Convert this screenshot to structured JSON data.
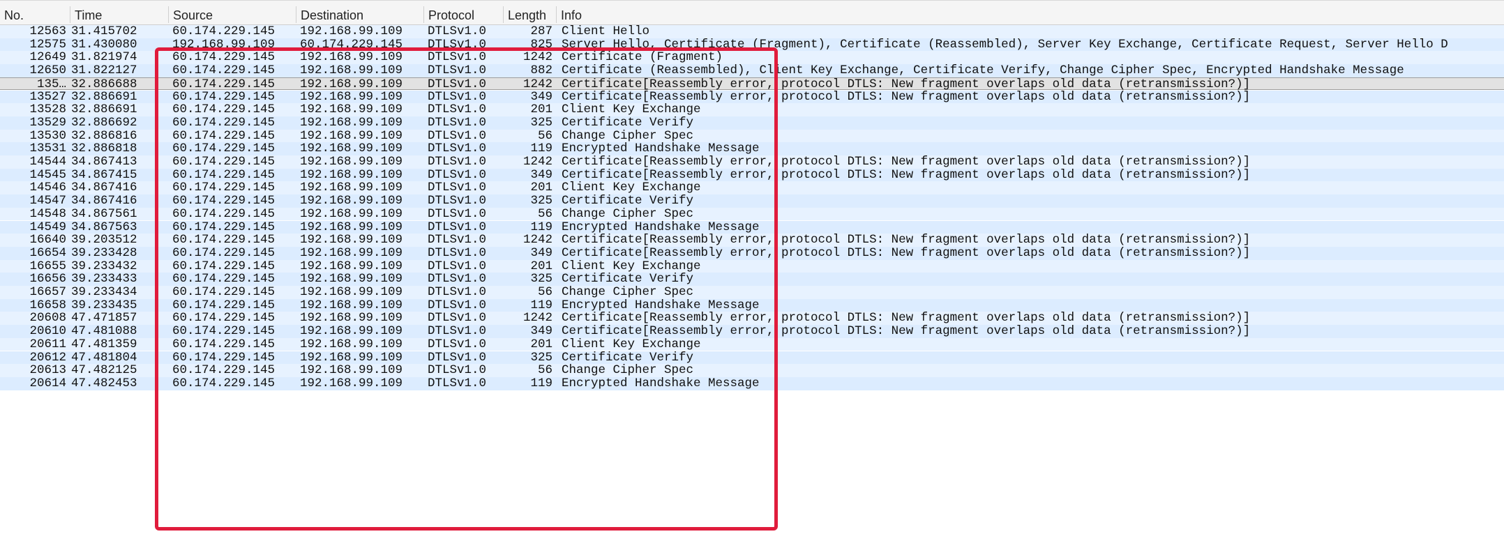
{
  "columns": [
    "No.",
    "Time",
    "Source",
    "Destination",
    "Protocol",
    "Length",
    "Info"
  ],
  "packets": [
    {
      "no": "12563",
      "time": "31.415702",
      "src": "60.174.229.145",
      "dst": "192.168.99.109",
      "proto": "DTLSv1.0",
      "len": "287",
      "info": "Client Hello"
    },
    {
      "no": "12575",
      "time": "31.430080",
      "src": "192.168.99.109",
      "dst": "60.174.229.145",
      "proto": "DTLSv1.0",
      "len": "825",
      "info": "Server Hello, Certificate (Fragment), Certificate (Reassembled), Server Key Exchange, Certificate Request, Server Hello D"
    },
    {
      "no": "12649",
      "time": "31.821974",
      "src": "60.174.229.145",
      "dst": "192.168.99.109",
      "proto": "DTLSv1.0",
      "len": "1242",
      "info": "Certificate (Fragment)"
    },
    {
      "no": "12650",
      "time": "31.822127",
      "src": "60.174.229.145",
      "dst": "192.168.99.109",
      "proto": "DTLSv1.0",
      "len": "882",
      "info": "Certificate (Reassembled), Client Key Exchange, Certificate Verify, Change Cipher Spec, Encrypted Handshake Message"
    },
    {
      "no": "135…",
      "time": "32.886688",
      "src": "60.174.229.145",
      "dst": "192.168.99.109",
      "proto": "DTLSv1.0",
      "len": "1242",
      "info": "Certificate[Reassembly error, protocol DTLS: New fragment overlaps old data (retransmission?)]"
    },
    {
      "no": "13527",
      "time": "32.886691",
      "src": "60.174.229.145",
      "dst": "192.168.99.109",
      "proto": "DTLSv1.0",
      "len": "349",
      "info": "Certificate[Reassembly error, protocol DTLS: New fragment overlaps old data (retransmission?)]"
    },
    {
      "no": "13528",
      "time": "32.886691",
      "src": "60.174.229.145",
      "dst": "192.168.99.109",
      "proto": "DTLSv1.0",
      "len": "201",
      "info": "Client Key Exchange"
    },
    {
      "no": "13529",
      "time": "32.886692",
      "src": "60.174.229.145",
      "dst": "192.168.99.109",
      "proto": "DTLSv1.0",
      "len": "325",
      "info": "Certificate Verify"
    },
    {
      "no": "13530",
      "time": "32.886816",
      "src": "60.174.229.145",
      "dst": "192.168.99.109",
      "proto": "DTLSv1.0",
      "len": "56",
      "info": "Change Cipher Spec"
    },
    {
      "no": "13531",
      "time": "32.886818",
      "src": "60.174.229.145",
      "dst": "192.168.99.109",
      "proto": "DTLSv1.0",
      "len": "119",
      "info": "Encrypted Handshake Message"
    },
    {
      "no": "14544",
      "time": "34.867413",
      "src": "60.174.229.145",
      "dst": "192.168.99.109",
      "proto": "DTLSv1.0",
      "len": "1242",
      "info": "Certificate[Reassembly error, protocol DTLS: New fragment overlaps old data (retransmission?)]"
    },
    {
      "no": "14545",
      "time": "34.867415",
      "src": "60.174.229.145",
      "dst": "192.168.99.109",
      "proto": "DTLSv1.0",
      "len": "349",
      "info": "Certificate[Reassembly error, protocol DTLS: New fragment overlaps old data (retransmission?)]"
    },
    {
      "no": "14546",
      "time": "34.867416",
      "src": "60.174.229.145",
      "dst": "192.168.99.109",
      "proto": "DTLSv1.0",
      "len": "201",
      "info": "Client Key Exchange"
    },
    {
      "no": "14547",
      "time": "34.867416",
      "src": "60.174.229.145",
      "dst": "192.168.99.109",
      "proto": "DTLSv1.0",
      "len": "325",
      "info": "Certificate Verify"
    },
    {
      "no": "14548",
      "time": "34.867561",
      "src": "60.174.229.145",
      "dst": "192.168.99.109",
      "proto": "DTLSv1.0",
      "len": "56",
      "info": "Change Cipher Spec"
    },
    {
      "no": "14549",
      "time": "34.867563",
      "src": "60.174.229.145",
      "dst": "192.168.99.109",
      "proto": "DTLSv1.0",
      "len": "119",
      "info": "Encrypted Handshake Message"
    },
    {
      "no": "16640",
      "time": "39.203512",
      "src": "60.174.229.145",
      "dst": "192.168.99.109",
      "proto": "DTLSv1.0",
      "len": "1242",
      "info": "Certificate[Reassembly error, protocol DTLS: New fragment overlaps old data (retransmission?)]"
    },
    {
      "no": "16654",
      "time": "39.233428",
      "src": "60.174.229.145",
      "dst": "192.168.99.109",
      "proto": "DTLSv1.0",
      "len": "349",
      "info": "Certificate[Reassembly error, protocol DTLS: New fragment overlaps old data (retransmission?)]"
    },
    {
      "no": "16655",
      "time": "39.233432",
      "src": "60.174.229.145",
      "dst": "192.168.99.109",
      "proto": "DTLSv1.0",
      "len": "201",
      "info": "Client Key Exchange"
    },
    {
      "no": "16656",
      "time": "39.233433",
      "src": "60.174.229.145",
      "dst": "192.168.99.109",
      "proto": "DTLSv1.0",
      "len": "325",
      "info": "Certificate Verify"
    },
    {
      "no": "16657",
      "time": "39.233434",
      "src": "60.174.229.145",
      "dst": "192.168.99.109",
      "proto": "DTLSv1.0",
      "len": "56",
      "info": "Change Cipher Spec"
    },
    {
      "no": "16658",
      "time": "39.233435",
      "src": "60.174.229.145",
      "dst": "192.168.99.109",
      "proto": "DTLSv1.0",
      "len": "119",
      "info": "Encrypted Handshake Message"
    },
    {
      "no": "20608",
      "time": "47.471857",
      "src": "60.174.229.145",
      "dst": "192.168.99.109",
      "proto": "DTLSv1.0",
      "len": "1242",
      "info": "Certificate[Reassembly error, protocol DTLS: New fragment overlaps old data (retransmission?)]"
    },
    {
      "no": "20610",
      "time": "47.481088",
      "src": "60.174.229.145",
      "dst": "192.168.99.109",
      "proto": "DTLSv1.0",
      "len": "349",
      "info": "Certificate[Reassembly error, protocol DTLS: New fragment overlaps old data (retransmission?)]"
    },
    {
      "no": "20611",
      "time": "47.481359",
      "src": "60.174.229.145",
      "dst": "192.168.99.109",
      "proto": "DTLSv1.0",
      "len": "201",
      "info": "Client Key Exchange"
    },
    {
      "no": "20612",
      "time": "47.481804",
      "src": "60.174.229.145",
      "dst": "192.168.99.109",
      "proto": "DTLSv1.0",
      "len": "325",
      "info": "Certificate Verify"
    },
    {
      "no": "20613",
      "time": "47.482125",
      "src": "60.174.229.145",
      "dst": "192.168.99.109",
      "proto": "DTLSv1.0",
      "len": "56",
      "info": "Change Cipher Spec"
    },
    {
      "no": "20614",
      "time": "47.482453",
      "src": "60.174.229.145",
      "dst": "192.168.99.109",
      "proto": "DTLSv1.0",
      "len": "119",
      "info": "Encrypted Handshake Message"
    }
  ],
  "selected_index": 4,
  "colors": {
    "row_bg": "#e7f2ff",
    "row_alt_bg": "#dcecff",
    "selected_bg": "#e2e2e2",
    "header_bg": "#f5f5f5",
    "highlight_border": "#e01c3c"
  }
}
